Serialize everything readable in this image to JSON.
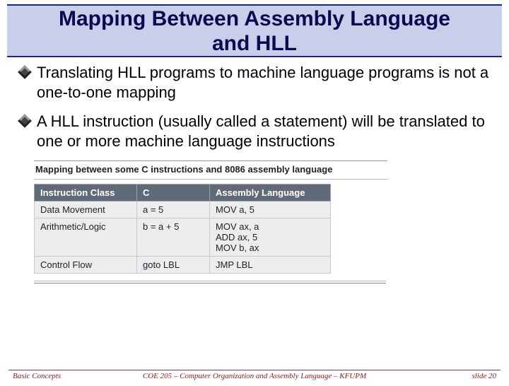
{
  "title_line1": "Mapping Between Assembly Language",
  "title_line2": "and HLL",
  "bullets": [
    "Translating HLL programs to machine language programs is not a one-to-one mapping",
    "A HLL instruction (usually called a statement) will be translated to one or more machine language instructions"
  ],
  "table": {
    "caption": "Mapping between some C instructions and 8086 assembly language",
    "headers": [
      "Instruction Class",
      "C",
      "Assembly Language"
    ],
    "rows": [
      {
        "ic": "Data Movement",
        "c": "a = 5",
        "al": "MOV a, 5"
      },
      {
        "ic": "Arithmetic/Logic",
        "c": "b = a + 5",
        "al": "MOV ax, a\nADD ax, 5\nMOV b, ax"
      },
      {
        "ic": "Control Flow",
        "c": "goto LBL",
        "al": "JMP LBL"
      }
    ]
  },
  "footer": {
    "left": "Basic Concepts",
    "center": "COE 205 – Computer Organization and Assembly Language – KFUPM",
    "right": "slide 20"
  }
}
